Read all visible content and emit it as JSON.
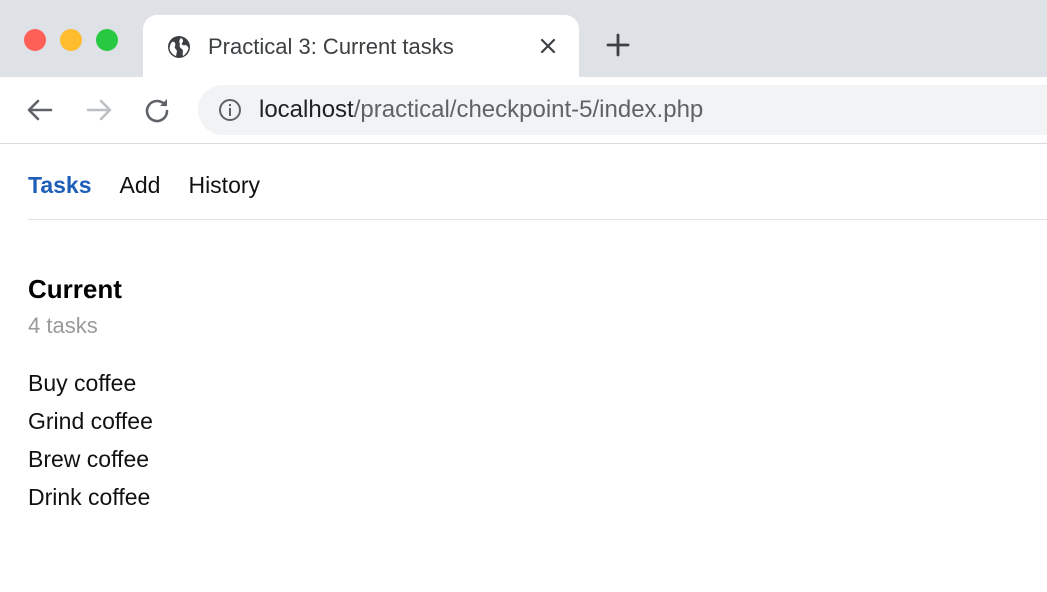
{
  "browser": {
    "tab_title": "Practical 3: Current tasks",
    "url_host": "localhost",
    "url_path": "/practical/checkpoint-5/index.php",
    "colors": {
      "close": "#fe5f57",
      "minimize": "#febc2e",
      "zoom": "#28c840",
      "tabstrip": "#dee1e6"
    },
    "icons": [
      "globe-icon",
      "close-icon",
      "plus-icon",
      "back-arrow-icon",
      "forward-arrow-icon",
      "reload-icon",
      "info-icon"
    ]
  },
  "nav": {
    "tasks_label": "Tasks",
    "add_label": "Add",
    "history_label": "History",
    "active": "Tasks",
    "active_color": "#1f5fb8"
  },
  "main": {
    "title": "Current",
    "count": "4 tasks",
    "tasks": [
      {
        "label": "Buy coffee"
      },
      {
        "label": "Grind coffee"
      },
      {
        "label": "Brew coffee"
      },
      {
        "label": "Drink coffee"
      }
    ]
  }
}
